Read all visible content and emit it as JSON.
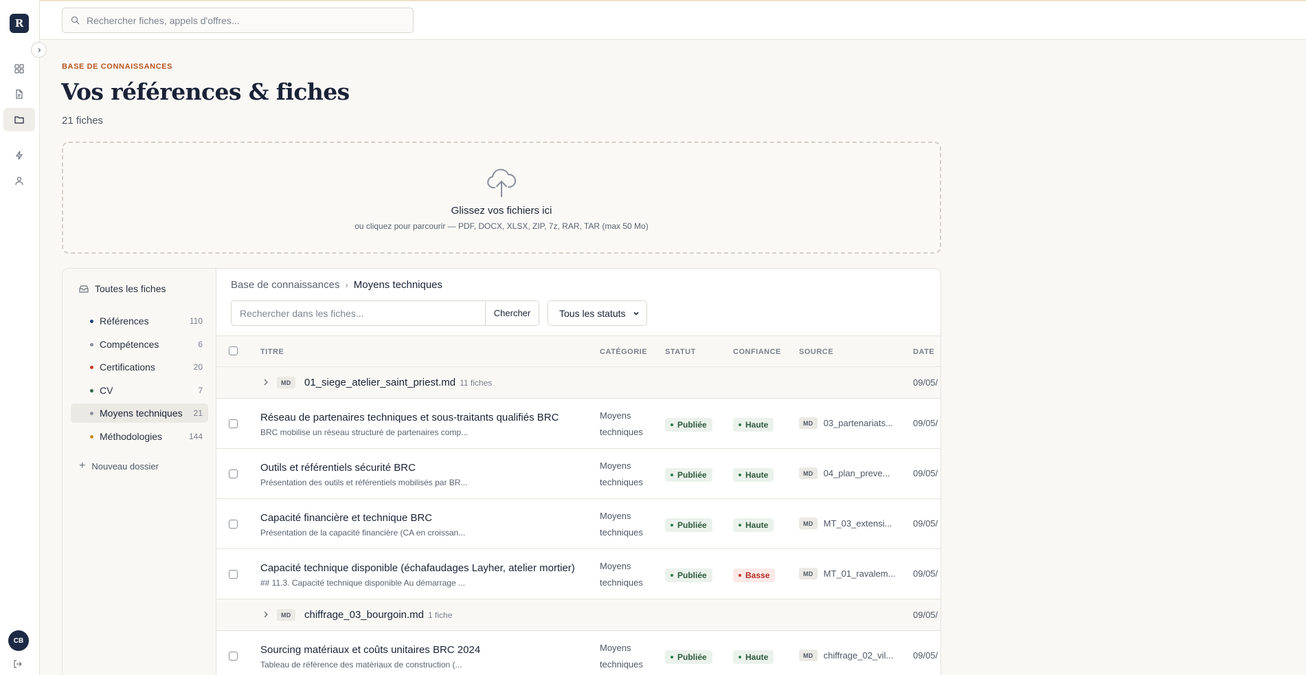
{
  "app": {
    "logo_letter": "R",
    "user_initials": "CB"
  },
  "search": {
    "placeholder": "Rechercher fiches, appels d'offres..."
  },
  "header": {
    "eyebrow": "BASE DE CONNAISSANCES",
    "title": "Vos références & fiches",
    "count": "21 fiches"
  },
  "dropzone": {
    "title": "Glissez vos fichiers ici",
    "subtitle": "ou cliquez pour parcourir — PDF, DOCX, XLSX, ZIP, 7z, RAR, TAR (max 50 Mo)"
  },
  "folders": {
    "all_label": "Toutes les fiches",
    "items": [
      {
        "label": "Références",
        "count": "110",
        "color": "#1f3f7a"
      },
      {
        "label": "Compétences",
        "count": "6",
        "color": "#8a8f99"
      },
      {
        "label": "Certifications",
        "count": "20",
        "color": "#c23b22"
      },
      {
        "label": "CV",
        "count": "7",
        "color": "#2e6b47"
      },
      {
        "label": "Moyens techniques",
        "count": "21",
        "color": "#8a8f99"
      },
      {
        "label": "Méthodologies",
        "count": "144",
        "color": "#c98a1a"
      }
    ],
    "new_folder_label": "Nouveau dossier"
  },
  "breadcrumb": {
    "root": "Base de connaissances",
    "current": "Moyens techniques"
  },
  "filters": {
    "search_placeholder": "Rechercher dans les fiches...",
    "search_button": "Chercher",
    "status_selected": "Tous les statuts"
  },
  "table": {
    "columns": {
      "title": "TITRE",
      "category": "CATÉGORIE",
      "status": "STATUT",
      "confidence": "CONFIANCE",
      "source": "SOURCE",
      "date": "DATE"
    },
    "md_label": "MD",
    "groups": [
      {
        "name": "01_siege_atelier_saint_priest.md",
        "count": "11 fiches",
        "date": "09/05/"
      },
      {
        "name": "chiffrage_03_bourgoin.md",
        "count": "1 fiche",
        "date": "09/05/"
      }
    ],
    "rows": [
      {
        "title": "Réseau de partenaires techniques et sous-traitants qualifiés BRC",
        "subtitle": "BRC mobilise un réseau structuré de partenaires comp...",
        "category": "Moyens techniques",
        "status": "Publiée",
        "confidence": "Haute",
        "source": "03_partenariats...",
        "date": "09/05/"
      },
      {
        "title": "Outils et référentiels sécurité BRC",
        "subtitle": "Présentation des outils et référentiels mobilisés par BR...",
        "category": "Moyens techniques",
        "status": "Publiée",
        "confidence": "Haute",
        "source": "04_plan_preve...",
        "date": "09/05/"
      },
      {
        "title": "Capacité financière et technique BRC",
        "subtitle": "Présentation de la capacité financière (CA en croissan...",
        "category": "Moyens techniques",
        "status": "Publiée",
        "confidence": "Haute",
        "source": "MT_03_extensi...",
        "date": "09/05/"
      },
      {
        "title": "Capacité technique disponible (échafaudages Layher, atelier mortier)",
        "subtitle": "## 11.3. Capacité technique disponible Au démarrage ...",
        "category": "Moyens techniques",
        "status": "Publiée",
        "confidence": "Basse",
        "source": "MT_01_ravalem...",
        "date": "09/05/"
      },
      {
        "title": "Sourcing matériaux et coûts unitaires BRC 2024",
        "subtitle": "Tableau de référence des matériaux de construction (...",
        "category": "Moyens techniques",
        "status": "Publiée",
        "confidence": "Haute",
        "source": "chiffrage_02_vil...",
        "date": "09/05/"
      }
    ]
  }
}
